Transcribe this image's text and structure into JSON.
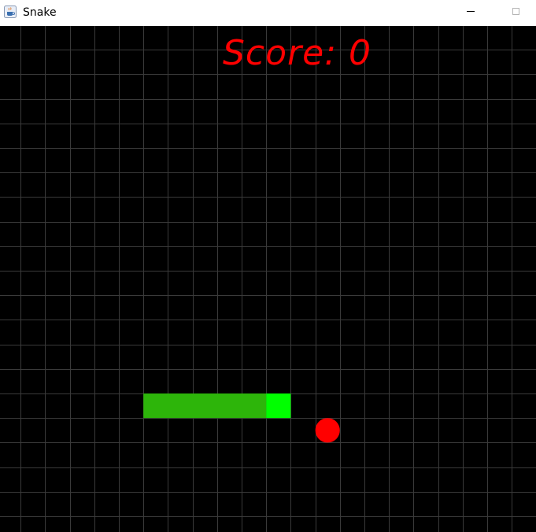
{
  "window": {
    "title": "Snake",
    "app_icon": "java-coffee-cup-icon",
    "minimize_icon": "minimize-icon",
    "maximize_icon": "maximize-icon"
  },
  "hud": {
    "score_label": "Score: 0",
    "score_value": 0,
    "score_color": "#ff0000"
  },
  "game": {
    "background_color": "#000000",
    "grid_color": "#3a3a3a",
    "grid_columns": 22,
    "grid_rows": 21,
    "snake_body_color": "#2db50a",
    "snake_head_color": "#00ff00",
    "apple_color": "#ff0000",
    "snake": {
      "row": 15,
      "head_col": 11,
      "length": 6,
      "direction": "right"
    },
    "apple": {
      "col": 13,
      "row": 16
    }
  }
}
